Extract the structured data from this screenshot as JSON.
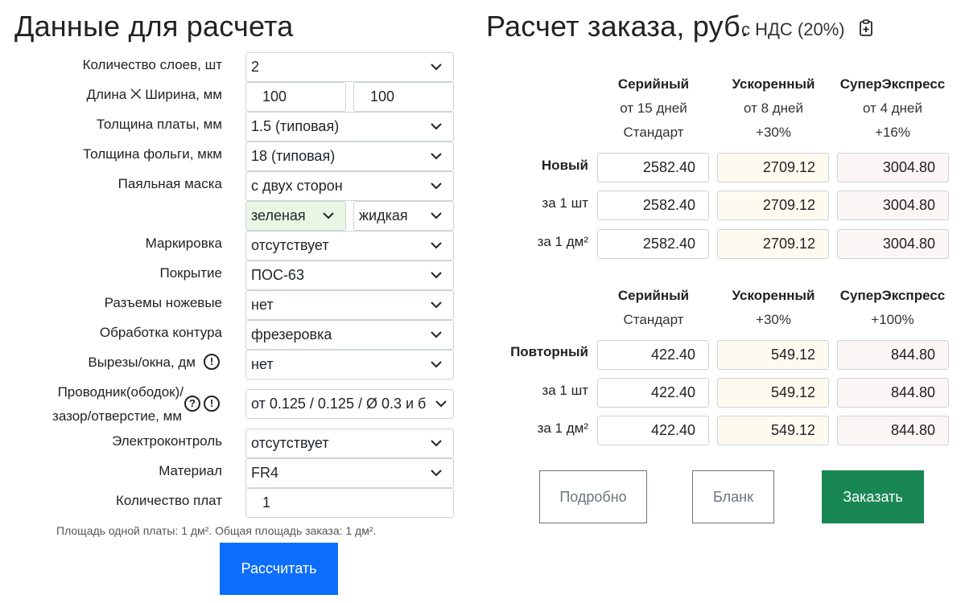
{
  "left": {
    "title": "Данные для расчета",
    "fields": {
      "layers": {
        "label": "Количество слоев, шт",
        "value": "2"
      },
      "size": {
        "label": "Длина ⨉ Ширина, мм",
        "length": "100",
        "width": "100"
      },
      "thickness": {
        "label": "Толщина платы, мм",
        "value": "1.5 (типовая)"
      },
      "foil": {
        "label": "Толщина фольги, мкм",
        "value": "18 (типовая)"
      },
      "mask": {
        "label": "Паяльная маска",
        "value": "с двух сторон",
        "color": "зеленая",
        "type": "жидкая"
      },
      "marking": {
        "label": "Маркировка",
        "value": "отсутствует"
      },
      "coating": {
        "label": "Покрытие",
        "value": "ПОС-63"
      },
      "connectors": {
        "label": "Разъемы ножевые",
        "value": "нет"
      },
      "contour": {
        "label": "Обработка контура",
        "value": "фрезеровка"
      },
      "cutouts": {
        "label": "Вырезы/окна, дм",
        "value": "нет"
      },
      "conductor": {
        "label_line1": "Проводник(ободок)/",
        "label_line2": "зазор/отверстие, мм",
        "value": "от 0.125 / 0.125 / Ø 0.3 и б"
      },
      "etest": {
        "label": "Электроконтроль",
        "value": "отсутствует"
      },
      "material": {
        "label": "Материал",
        "value": "FR4"
      },
      "quantity": {
        "label": "Количество плат",
        "value": "1"
      }
    },
    "area_note": "Площадь одной платы: 1 дм². Общая площадь заказа: 1 дм².",
    "calc_button": "Рассчитать"
  },
  "right": {
    "title": "Расчет заказа, руб.",
    "vat": "с НДС (20%)",
    "new": {
      "columns": [
        {
          "title": "Серийный",
          "line2": "от 15 дней",
          "line3": "Стандарт"
        },
        {
          "title": "Ускоренный",
          "line2": "от 8 дней",
          "line3": "+30%"
        },
        {
          "title": "СуперЭкспресс",
          "line2": "от 4 дней",
          "line3": "+16%"
        }
      ],
      "rows": [
        {
          "label": "Новый",
          "values": [
            "2582.40",
            "2709.12",
            "3004.80"
          ]
        },
        {
          "label": "за 1 шт",
          "values": [
            "2582.40",
            "2709.12",
            "3004.80"
          ]
        },
        {
          "label": "за 1 дм²",
          "values": [
            "2582.40",
            "2709.12",
            "3004.80"
          ]
        }
      ]
    },
    "repeat": {
      "columns": [
        {
          "title": "Серийный",
          "line2": "Стандарт"
        },
        {
          "title": "Ускоренный",
          "line2": "+30%"
        },
        {
          "title": "СуперЭкспресс",
          "line2": "+100%"
        }
      ],
      "rows": [
        {
          "label": "Повторный",
          "values": [
            "422.40",
            "549.12",
            "844.80"
          ]
        },
        {
          "label": "за 1 шт",
          "values": [
            "422.40",
            "549.12",
            "844.80"
          ]
        },
        {
          "label": "за 1 дм²",
          "values": [
            "422.40",
            "549.12",
            "844.80"
          ]
        }
      ]
    },
    "buttons": {
      "details": "Подробно",
      "blank": "Бланк",
      "order": "Заказать"
    }
  },
  "colors": {
    "primary": "#0d6efd",
    "success": "#198754",
    "mask_green_bg": "#eaf6e4",
    "cell_yellow": "#fdfaf0",
    "cell_pink": "#fbf5f5"
  },
  "icons": [
    "chevron-down-icon",
    "clipboard-plus-icon",
    "exclamation-circle-icon",
    "question-circle-icon"
  ]
}
